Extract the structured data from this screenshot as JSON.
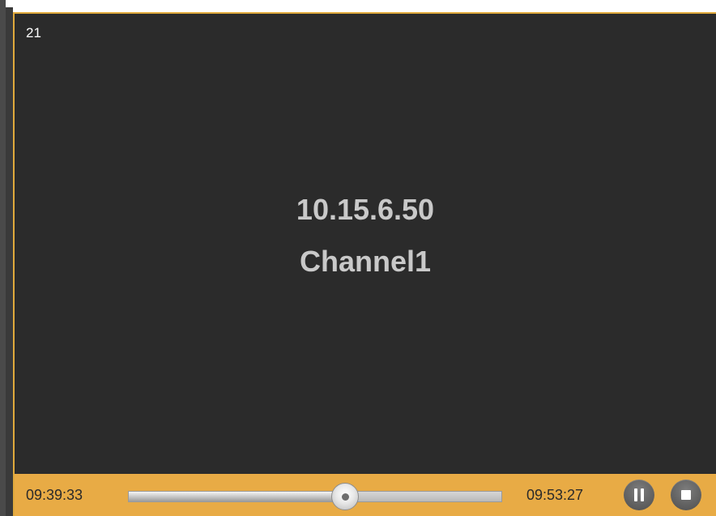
{
  "player": {
    "window_number": "21",
    "device_ip": "10.15.6.50",
    "channel_name": "Channel1",
    "colors": {
      "accent": "#e8ab45",
      "video_background": "#2b2b2b",
      "label_text": "#c9c9c9"
    }
  },
  "playback": {
    "start_time": "09:39:33",
    "end_time": "09:53:27",
    "progress_fraction": 0.58,
    "pause_icon": "pause-icon",
    "stop_icon": "stop-icon"
  }
}
